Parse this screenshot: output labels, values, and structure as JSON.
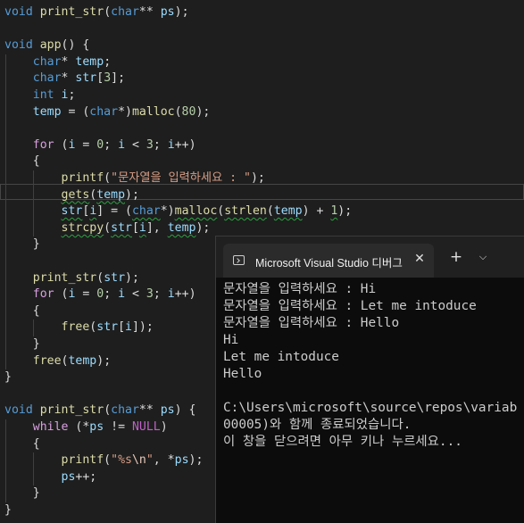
{
  "editor": {
    "lines": [
      [
        [
          "kw",
          "void"
        ],
        [
          "def",
          " "
        ],
        [
          "fn",
          "print_str"
        ],
        [
          "def",
          "("
        ],
        [
          "kw",
          "char"
        ],
        [
          "def",
          "** "
        ],
        [
          "par",
          "ps"
        ],
        [
          "def",
          ");"
        ]
      ],
      [],
      [
        [
          "kw",
          "void"
        ],
        [
          "def",
          " "
        ],
        [
          "fn",
          "app"
        ],
        [
          "def",
          "() {"
        ]
      ],
      [
        [
          "def",
          "    "
        ],
        [
          "kw",
          "char"
        ],
        [
          "def",
          "* "
        ],
        [
          "var",
          "temp"
        ],
        [
          "def",
          ";"
        ]
      ],
      [
        [
          "def",
          "    "
        ],
        [
          "kw",
          "char"
        ],
        [
          "def",
          "* "
        ],
        [
          "var",
          "str"
        ],
        [
          "def",
          "["
        ],
        [
          "num",
          "3"
        ],
        [
          "def",
          "];"
        ]
      ],
      [
        [
          "def",
          "    "
        ],
        [
          "kw",
          "int"
        ],
        [
          "def",
          " "
        ],
        [
          "var",
          "i"
        ],
        [
          "def",
          ";"
        ]
      ],
      [
        [
          "def",
          "    "
        ],
        [
          "var",
          "temp"
        ],
        [
          "def",
          " = ("
        ],
        [
          "kw",
          "char"
        ],
        [
          "def",
          "*)"
        ],
        [
          "fn",
          "malloc"
        ],
        [
          "def",
          "("
        ],
        [
          "num",
          "80"
        ],
        [
          "def",
          ");"
        ]
      ],
      [],
      [
        [
          "def",
          "    "
        ],
        [
          "ctl",
          "for"
        ],
        [
          "def",
          " ("
        ],
        [
          "var",
          "i"
        ],
        [
          "def",
          " = "
        ],
        [
          "num",
          "0"
        ],
        [
          "def",
          "; "
        ],
        [
          "var",
          "i"
        ],
        [
          "def",
          " < "
        ],
        [
          "num",
          "3"
        ],
        [
          "def",
          "; "
        ],
        [
          "var",
          "i"
        ],
        [
          "def",
          "++)"
        ]
      ],
      [
        [
          "def",
          "    {"
        ]
      ],
      [
        [
          "def",
          "        "
        ],
        [
          "fn",
          "printf"
        ],
        [
          "def",
          "("
        ],
        [
          "str",
          "\"문자열을 입력하세요 : \""
        ],
        [
          "def",
          ");"
        ]
      ],
      [
        [
          "def",
          "        "
        ],
        [
          "fn",
          "gets"
        ],
        [
          "def",
          "("
        ],
        [
          "var",
          "temp"
        ],
        [
          "def",
          ");"
        ]
      ],
      [
        [
          "def",
          "        "
        ],
        [
          "var",
          "str"
        ],
        [
          "def",
          "["
        ],
        [
          "var",
          "i"
        ],
        [
          "def",
          "] = ("
        ],
        [
          "kw",
          "char"
        ],
        [
          "def",
          "*)"
        ],
        [
          "fn",
          "malloc"
        ],
        [
          "def",
          "("
        ],
        [
          "fn",
          "strlen"
        ],
        [
          "def",
          "("
        ],
        [
          "var",
          "temp"
        ],
        [
          "def",
          ") + "
        ],
        [
          "num",
          "1"
        ],
        [
          "def",
          ");"
        ]
      ],
      [
        [
          "def",
          "        "
        ],
        [
          "fn",
          "strcpy"
        ],
        [
          "def",
          "("
        ],
        [
          "var",
          "str"
        ],
        [
          "def",
          "["
        ],
        [
          "var",
          "i"
        ],
        [
          "def",
          "], "
        ],
        [
          "var",
          "temp"
        ],
        [
          "def",
          ");"
        ]
      ],
      [
        [
          "def",
          "    }"
        ]
      ],
      [],
      [
        [
          "def",
          "    "
        ],
        [
          "fn",
          "print_str"
        ],
        [
          "def",
          "("
        ],
        [
          "var",
          "str"
        ],
        [
          "def",
          ");"
        ]
      ],
      [
        [
          "def",
          "    "
        ],
        [
          "ctl",
          "for"
        ],
        [
          "def",
          " ("
        ],
        [
          "var",
          "i"
        ],
        [
          "def",
          " = "
        ],
        [
          "num",
          "0"
        ],
        [
          "def",
          "; "
        ],
        [
          "var",
          "i"
        ],
        [
          "def",
          " < "
        ],
        [
          "num",
          "3"
        ],
        [
          "def",
          "; "
        ],
        [
          "var",
          "i"
        ],
        [
          "def",
          "++)"
        ]
      ],
      [
        [
          "def",
          "    {"
        ]
      ],
      [
        [
          "def",
          "        "
        ],
        [
          "fn",
          "free"
        ],
        [
          "def",
          "("
        ],
        [
          "var",
          "str"
        ],
        [
          "def",
          "["
        ],
        [
          "var",
          "i"
        ],
        [
          "def",
          "]);"
        ]
      ],
      [
        [
          "def",
          "    }"
        ]
      ],
      [
        [
          "def",
          "    "
        ],
        [
          "fn",
          "free"
        ],
        [
          "def",
          "("
        ],
        [
          "var",
          "temp"
        ],
        [
          "def",
          ");"
        ]
      ],
      [
        [
          "def",
          "}"
        ]
      ],
      [],
      [
        [
          "kw",
          "void"
        ],
        [
          "def",
          " "
        ],
        [
          "fn",
          "print_str"
        ],
        [
          "def",
          "("
        ],
        [
          "kw",
          "char"
        ],
        [
          "def",
          "** "
        ],
        [
          "par",
          "ps"
        ],
        [
          "def",
          ") {"
        ]
      ],
      [
        [
          "def",
          "    "
        ],
        [
          "ctl",
          "while"
        ],
        [
          "def",
          " (*"
        ],
        [
          "par",
          "ps"
        ],
        [
          "def",
          " != "
        ],
        [
          "mac",
          "NULL"
        ],
        [
          "def",
          ")"
        ]
      ],
      [
        [
          "def",
          "    {"
        ]
      ],
      [
        [
          "def",
          "        "
        ],
        [
          "fn",
          "printf"
        ],
        [
          "def",
          "("
        ],
        [
          "str",
          "\"%s"
        ],
        [
          "esc",
          "\\n"
        ],
        [
          "str",
          "\""
        ],
        [
          "def",
          ", *"
        ],
        [
          "par",
          "ps"
        ],
        [
          "def",
          ");"
        ]
      ],
      [
        [
          "def",
          "        "
        ],
        [
          "par",
          "ps"
        ],
        [
          "def",
          "++;"
        ]
      ],
      [
        [
          "def",
          "    }"
        ]
      ],
      [
        [
          "def",
          "}"
        ]
      ]
    ]
  },
  "terminal": {
    "tab_title": "Microsoft Visual Studio 디버그",
    "close_glyph": "✕",
    "add_glyph": "+",
    "dropdown_glyph": "⌵",
    "output": [
      "문자열을 입력하세요 : Hi",
      "문자열을 입력하세요 : Let me intoduce",
      "문자열을 입력하세요 : Hello",
      "Hi",
      "Let me intoduce",
      "Hello",
      "",
      "C:\\Users\\microsoft\\source\\repos\\variab",
      "00005)와 함께 종료되었습니다.",
      "이 창을 닫으려면 아무 키나 누르세요..."
    ]
  }
}
